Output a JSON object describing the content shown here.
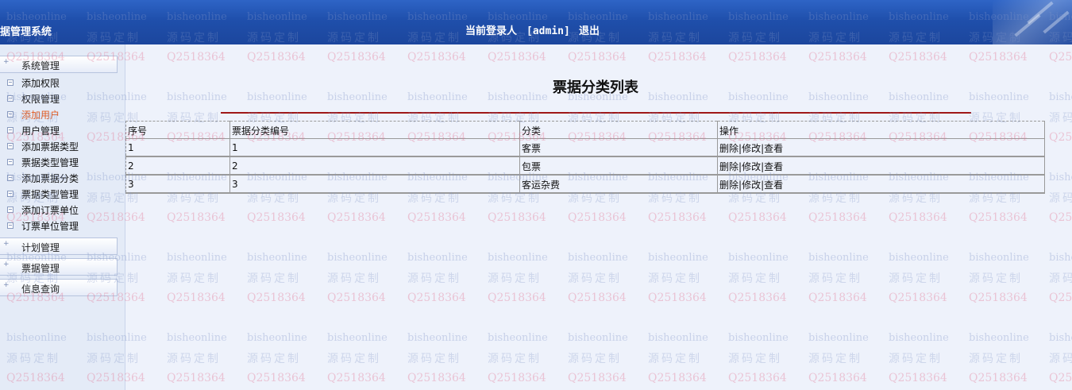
{
  "header": {
    "app_title": "据管理系统",
    "login_label": "当前登录人",
    "username": "[admin]",
    "logout": "退出"
  },
  "watermark": {
    "line1": "bisheonline",
    "line2": "源码定制",
    "line3": "Q2518364"
  },
  "sidebar": {
    "groups": [
      {
        "label": "系统管理"
      },
      {
        "label": "计划管理"
      },
      {
        "label": "票据管理"
      },
      {
        "label": "信息查询"
      }
    ],
    "items": [
      {
        "label": "添加权限"
      },
      {
        "label": "权限管理"
      },
      {
        "label": "添加用户"
      },
      {
        "label": "用户管理"
      },
      {
        "label": "添加票据类型"
      },
      {
        "label": "票据类型管理"
      },
      {
        "label": "添加票据分类"
      },
      {
        "label": "票据类型管理"
      },
      {
        "label": "添加订票单位"
      },
      {
        "label": "订票单位管理"
      }
    ]
  },
  "main": {
    "title": "票据分类列表",
    "table": {
      "headers": [
        "序号",
        "票据分类编号",
        "分类",
        "操作"
      ],
      "rows": [
        {
          "no": "1",
          "code": "1",
          "category": "客票"
        },
        {
          "no": "2",
          "code": "2",
          "category": "包票"
        },
        {
          "no": "3",
          "code": "3",
          "category": "客运杂费"
        }
      ],
      "actions": {
        "delete": "删除",
        "edit": "修改",
        "view": "查看",
        "sep": "|"
      }
    }
  }
}
